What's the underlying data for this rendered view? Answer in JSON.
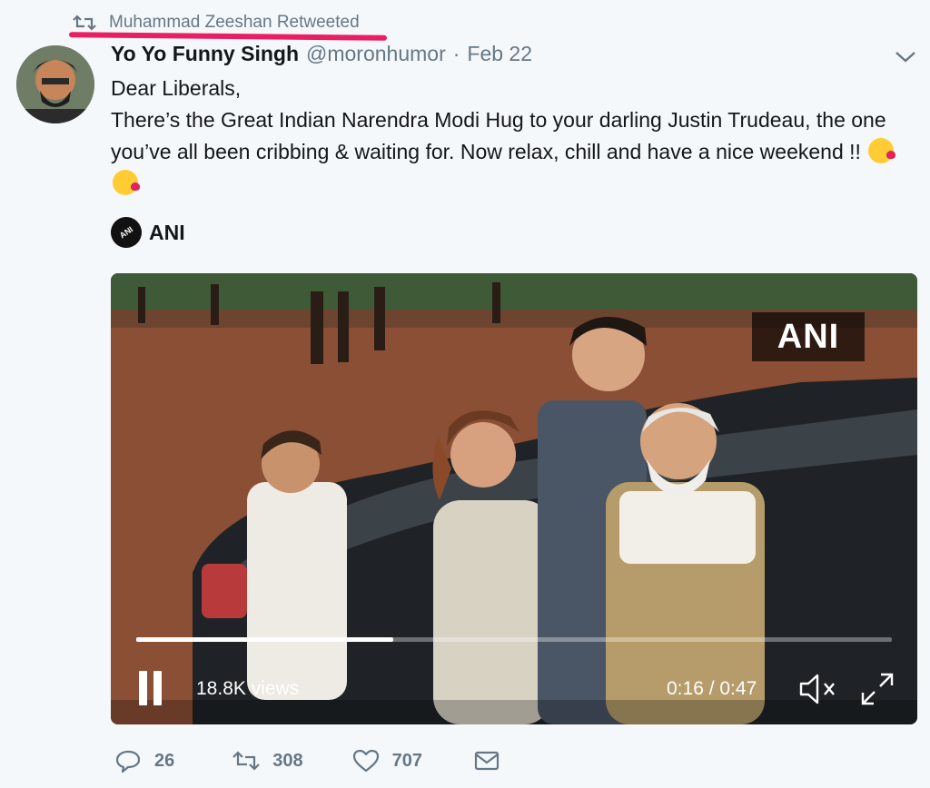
{
  "retweet_context": {
    "text": "Muhammad Zeeshan Retweeted",
    "icon": "retweet-icon"
  },
  "tweet": {
    "display_name": "Yo Yo Funny Singh",
    "handle": "@moronhumor",
    "separator": "·",
    "date": "Feb 22",
    "text_line1": "Dear Liberals,",
    "text_body": "There’s the Great Indian Narendra Modi Hug to your darling Justin Trudeau, the one you’ve all been cribbing & waiting for. Now relax, chill and have a nice weekend !!",
    "emojis": [
      "kissing-face-emoji",
      "kissing-face-emoji"
    ]
  },
  "quote": {
    "account_name": "ANI",
    "logo_text": "ANI"
  },
  "video": {
    "watermark": "ANI",
    "views": "18.8K views",
    "time": "0:16 / 0:47",
    "progress": 0.34,
    "state": "playing"
  },
  "actions": {
    "replies": "26",
    "retweets": "308",
    "likes": "707"
  },
  "colors": {
    "background": "#f5f8fa",
    "secondary_text": "#657786",
    "underline": "#e91e63"
  }
}
